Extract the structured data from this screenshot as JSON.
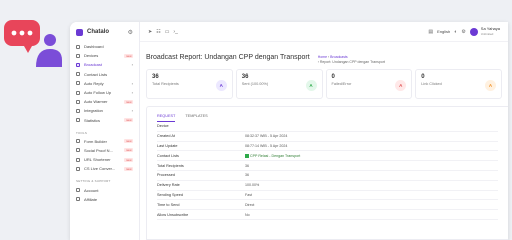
{
  "app": {
    "name": "Chatalo"
  },
  "colors": {
    "brand": "#6b3ad4",
    "badge_bg": "#ffe3e3",
    "badge_fg": "#e05555",
    "success": "#2eaa4a"
  },
  "sidebar": {
    "items": [
      {
        "label": "Dashboard",
        "icon": "dashboard-icon"
      },
      {
        "label": "Devices",
        "badge": "new",
        "icon": "device-icon"
      },
      {
        "label": "Broadcast",
        "active": true,
        "chevron": "›",
        "icon": "broadcast-icon"
      },
      {
        "label": "Contact Lists",
        "icon": "contacts-icon"
      },
      {
        "label": "Auto Reply",
        "chevron": "›",
        "icon": "reply-icon"
      },
      {
        "label": "Auto Follow Up",
        "chevron": "›",
        "icon": "follow-up-icon"
      },
      {
        "label": "Auto Warmer",
        "badge": "new",
        "icon": "flame-icon"
      },
      {
        "label": "Integration",
        "chevron": "›",
        "icon": "plug-icon"
      },
      {
        "label": "Statistics",
        "badge": "new",
        "icon": "chart-icon"
      }
    ],
    "tools_title": "TOOLS",
    "tools": [
      {
        "label": "Form Builder",
        "badge": "new"
      },
      {
        "label": "Social Proof N...",
        "badge": "new"
      },
      {
        "label": "URL Shortener",
        "badge": "new"
      },
      {
        "label": "CS Live Conver...",
        "badge": "new"
      }
    ],
    "settings_title": "SETTING & SUPPORT",
    "settings": [
      {
        "label": "Account"
      },
      {
        "label": "Affiliate"
      }
    ]
  },
  "topbar": {
    "icons": [
      "send-icon",
      "people-icon",
      "device-icon",
      "command-icon"
    ],
    "language": "English",
    "user_name": "Sa Yahaya",
    "user_role": "Unlimited"
  },
  "page": {
    "title": "Broadcast Report: Undangan CPP dengan Transport",
    "breadcrumb_home": "Home",
    "breadcrumb_section": "Broadcasts",
    "breadcrumb_current": "Report: Undangan CPP dengan Transport"
  },
  "stats": [
    {
      "value": "36",
      "label": "Total Recipients",
      "icon_text": "A",
      "bg": "#ece8ff",
      "fg": "#6b3ad4"
    },
    {
      "value": "36",
      "label": "Sent (100.00%)",
      "icon_text": "A",
      "bg": "#e3f7ea",
      "fg": "#2eaa4a"
    },
    {
      "value": "0",
      "label": "Failed/Error",
      "icon_text": "A",
      "bg": "#ffe8e8",
      "fg": "#e05555"
    },
    {
      "value": "0",
      "label": "Link Clicked",
      "icon_text": "A",
      "bg": "#fff1e0",
      "fg": "#f0932b"
    }
  ],
  "tabs": [
    "REQUEST",
    "TEMPLATES"
  ],
  "details": [
    {
      "label": "Device",
      "value": ""
    },
    {
      "label": "Created At",
      "value": "08:32:37 WIB - 5 Apr 2024"
    },
    {
      "label": "Last Update",
      "value": "08:77:14 WIB - 5 Apr 2024"
    },
    {
      "label": "Contact Lists",
      "value": "CPP Relasi - Dengan Transport",
      "check": true
    },
    {
      "label": "Total Recipients",
      "value": "36"
    },
    {
      "label": "Processed",
      "value": "36"
    },
    {
      "label": "Delivery Rate",
      "value": "100.00%"
    },
    {
      "label": "Sending Speed",
      "value": "Fast"
    },
    {
      "label": "Time to Send",
      "value": "Direct"
    },
    {
      "label": "Allow Unsubscribe",
      "value": "No"
    }
  ]
}
